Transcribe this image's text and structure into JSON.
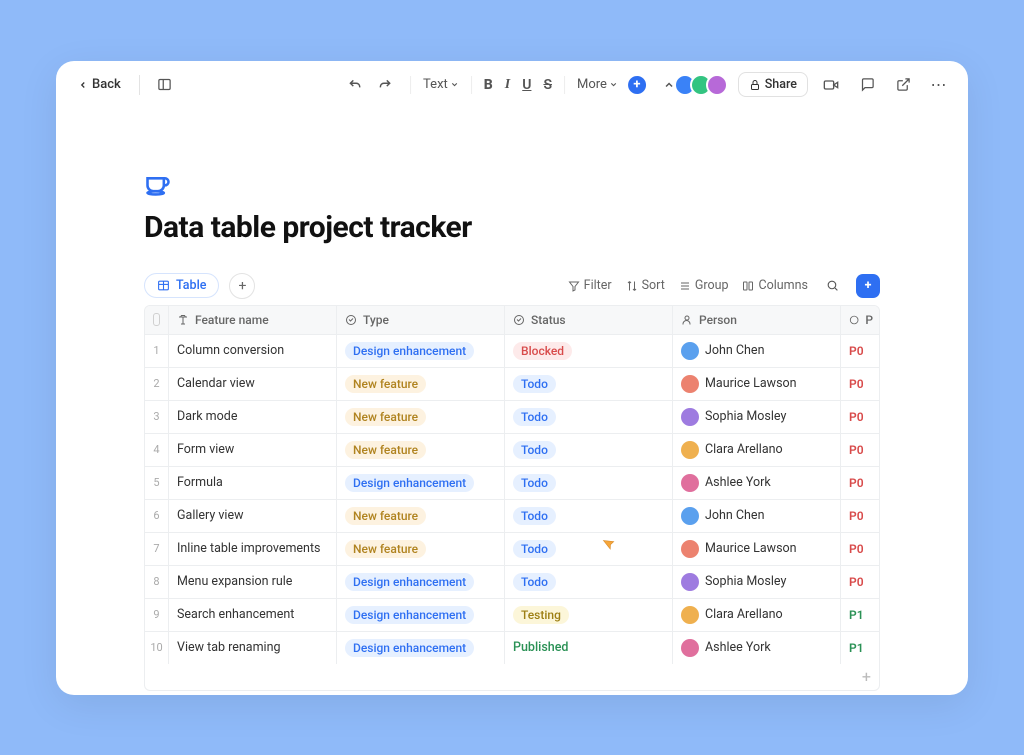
{
  "topbar": {
    "back_label": "Back",
    "text_menu": "Text",
    "more_menu": "More",
    "share_label": "Share",
    "avatar_colors": [
      "#3a82f7",
      "#33c481",
      "#b769d8"
    ]
  },
  "page": {
    "icon": "coffee-icon",
    "title": "Data table project tracker"
  },
  "tableToolbar": {
    "tab_label": "Table",
    "filter": "Filter",
    "sort": "Sort",
    "group": "Group",
    "columns": "Columns"
  },
  "columns": [
    {
      "label": "Feature name",
      "icon": "text-icon"
    },
    {
      "label": "Type",
      "icon": "select-icon"
    },
    {
      "label": "Status",
      "icon": "select-icon"
    },
    {
      "label": "Person",
      "icon": "person-icon"
    },
    {
      "label": "P",
      "icon": "select-icon"
    }
  ],
  "type_styles": {
    "Design enhancement": "pill-blue",
    "New feature": "pill-amber"
  },
  "status_styles": {
    "Blocked": "pill-red",
    "Todo": "pill-sky",
    "Testing": "pill-yellow",
    "Published": "txt-green"
  },
  "priority_styles": {
    "P0": "p-red",
    "P1": "p-green"
  },
  "person_avatar_colors": {
    "John Chen": "#5aa0ee",
    "Maurice Lawson": "#ec826f",
    "Sophia Mosley": "#9e7be0",
    "Clara Arellano": "#efb04f",
    "Ashlee York": "#e06f9d"
  },
  "rows": [
    {
      "feature": "Column conversion",
      "type": "Design enhancement",
      "status": "Blocked",
      "person": "John Chen",
      "priority": "P0"
    },
    {
      "feature": "Calendar view",
      "type": "New feature",
      "status": "Todo",
      "person": "Maurice Lawson",
      "priority": "P0"
    },
    {
      "feature": "Dark mode",
      "type": "New feature",
      "status": "Todo",
      "person": "Sophia Mosley",
      "priority": "P0"
    },
    {
      "feature": "Form view",
      "type": "New feature",
      "status": "Todo",
      "person": "Clara Arellano",
      "priority": "P0"
    },
    {
      "feature": "Formula",
      "type": "Design enhancement",
      "status": "Todo",
      "person": "Ashlee York",
      "priority": "P0"
    },
    {
      "feature": "Gallery view",
      "type": "New feature",
      "status": "Todo",
      "person": "John Chen",
      "priority": "P0"
    },
    {
      "feature": "Inline table improvements",
      "type": "New feature",
      "status": "Todo",
      "person": "Maurice Lawson",
      "priority": "P0"
    },
    {
      "feature": "Menu expansion rule",
      "type": "Design enhancement",
      "status": "Todo",
      "person": "Sophia Mosley",
      "priority": "P0"
    },
    {
      "feature": "Search enhancement",
      "type": "Design enhancement",
      "status": "Testing",
      "person": "Clara Arellano",
      "priority": "P1"
    },
    {
      "feature": "View tab renaming",
      "type": "Design enhancement",
      "status": "Published",
      "person": "Ashlee York",
      "priority": "P1"
    }
  ]
}
